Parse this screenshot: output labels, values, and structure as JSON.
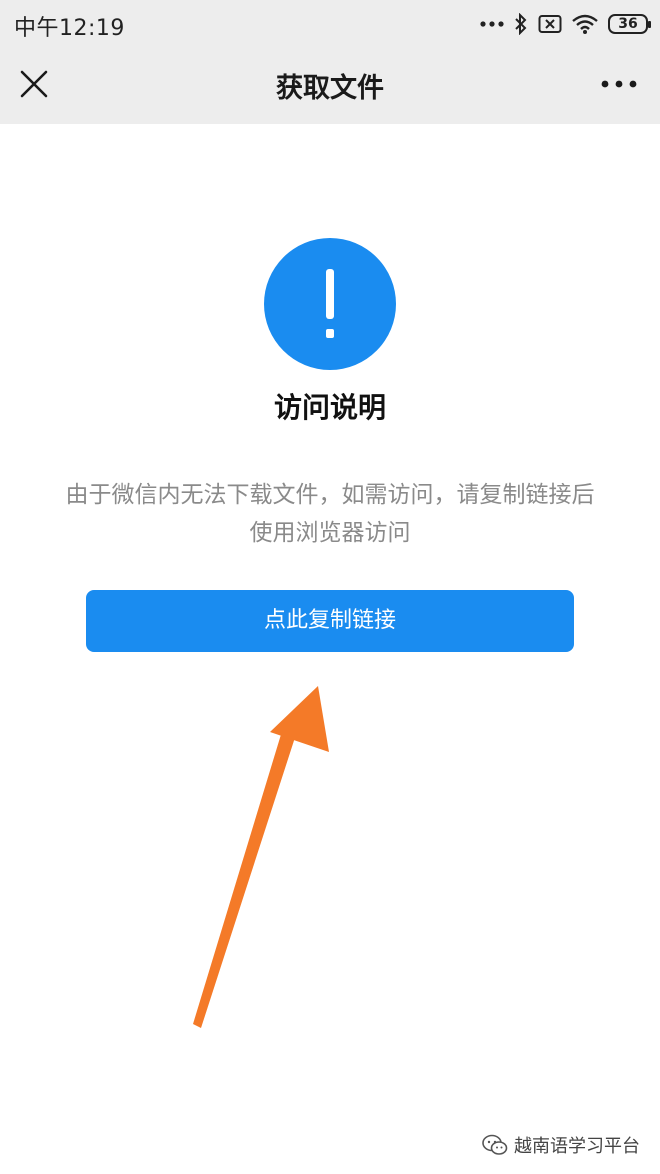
{
  "status_bar": {
    "time": "中午12:19",
    "battery": "36",
    "icons": [
      "more-dots-icon",
      "bluetooth-icon",
      "no-sim-icon",
      "wifi-icon",
      "battery-icon"
    ]
  },
  "nav": {
    "title": "获取文件",
    "close_icon": "close-icon",
    "more_icon": "more-icon"
  },
  "main": {
    "alert_icon": "exclamation-circle-icon",
    "alert_color": "#1a8cf0",
    "heading": "访问说明",
    "description_line1": "由于微信内无法下载文件，如需访问，请复制链接后",
    "description_line2": "使用浏览器访问",
    "button_label": "点此复制链接",
    "button_color": "#1a8cf0"
  },
  "annotation": {
    "arrow_icon": "pointer-arrow-icon",
    "arrow_color": "#f47a28"
  },
  "watermark": {
    "icon": "wechat-icon",
    "text": "越南语学习平台"
  }
}
